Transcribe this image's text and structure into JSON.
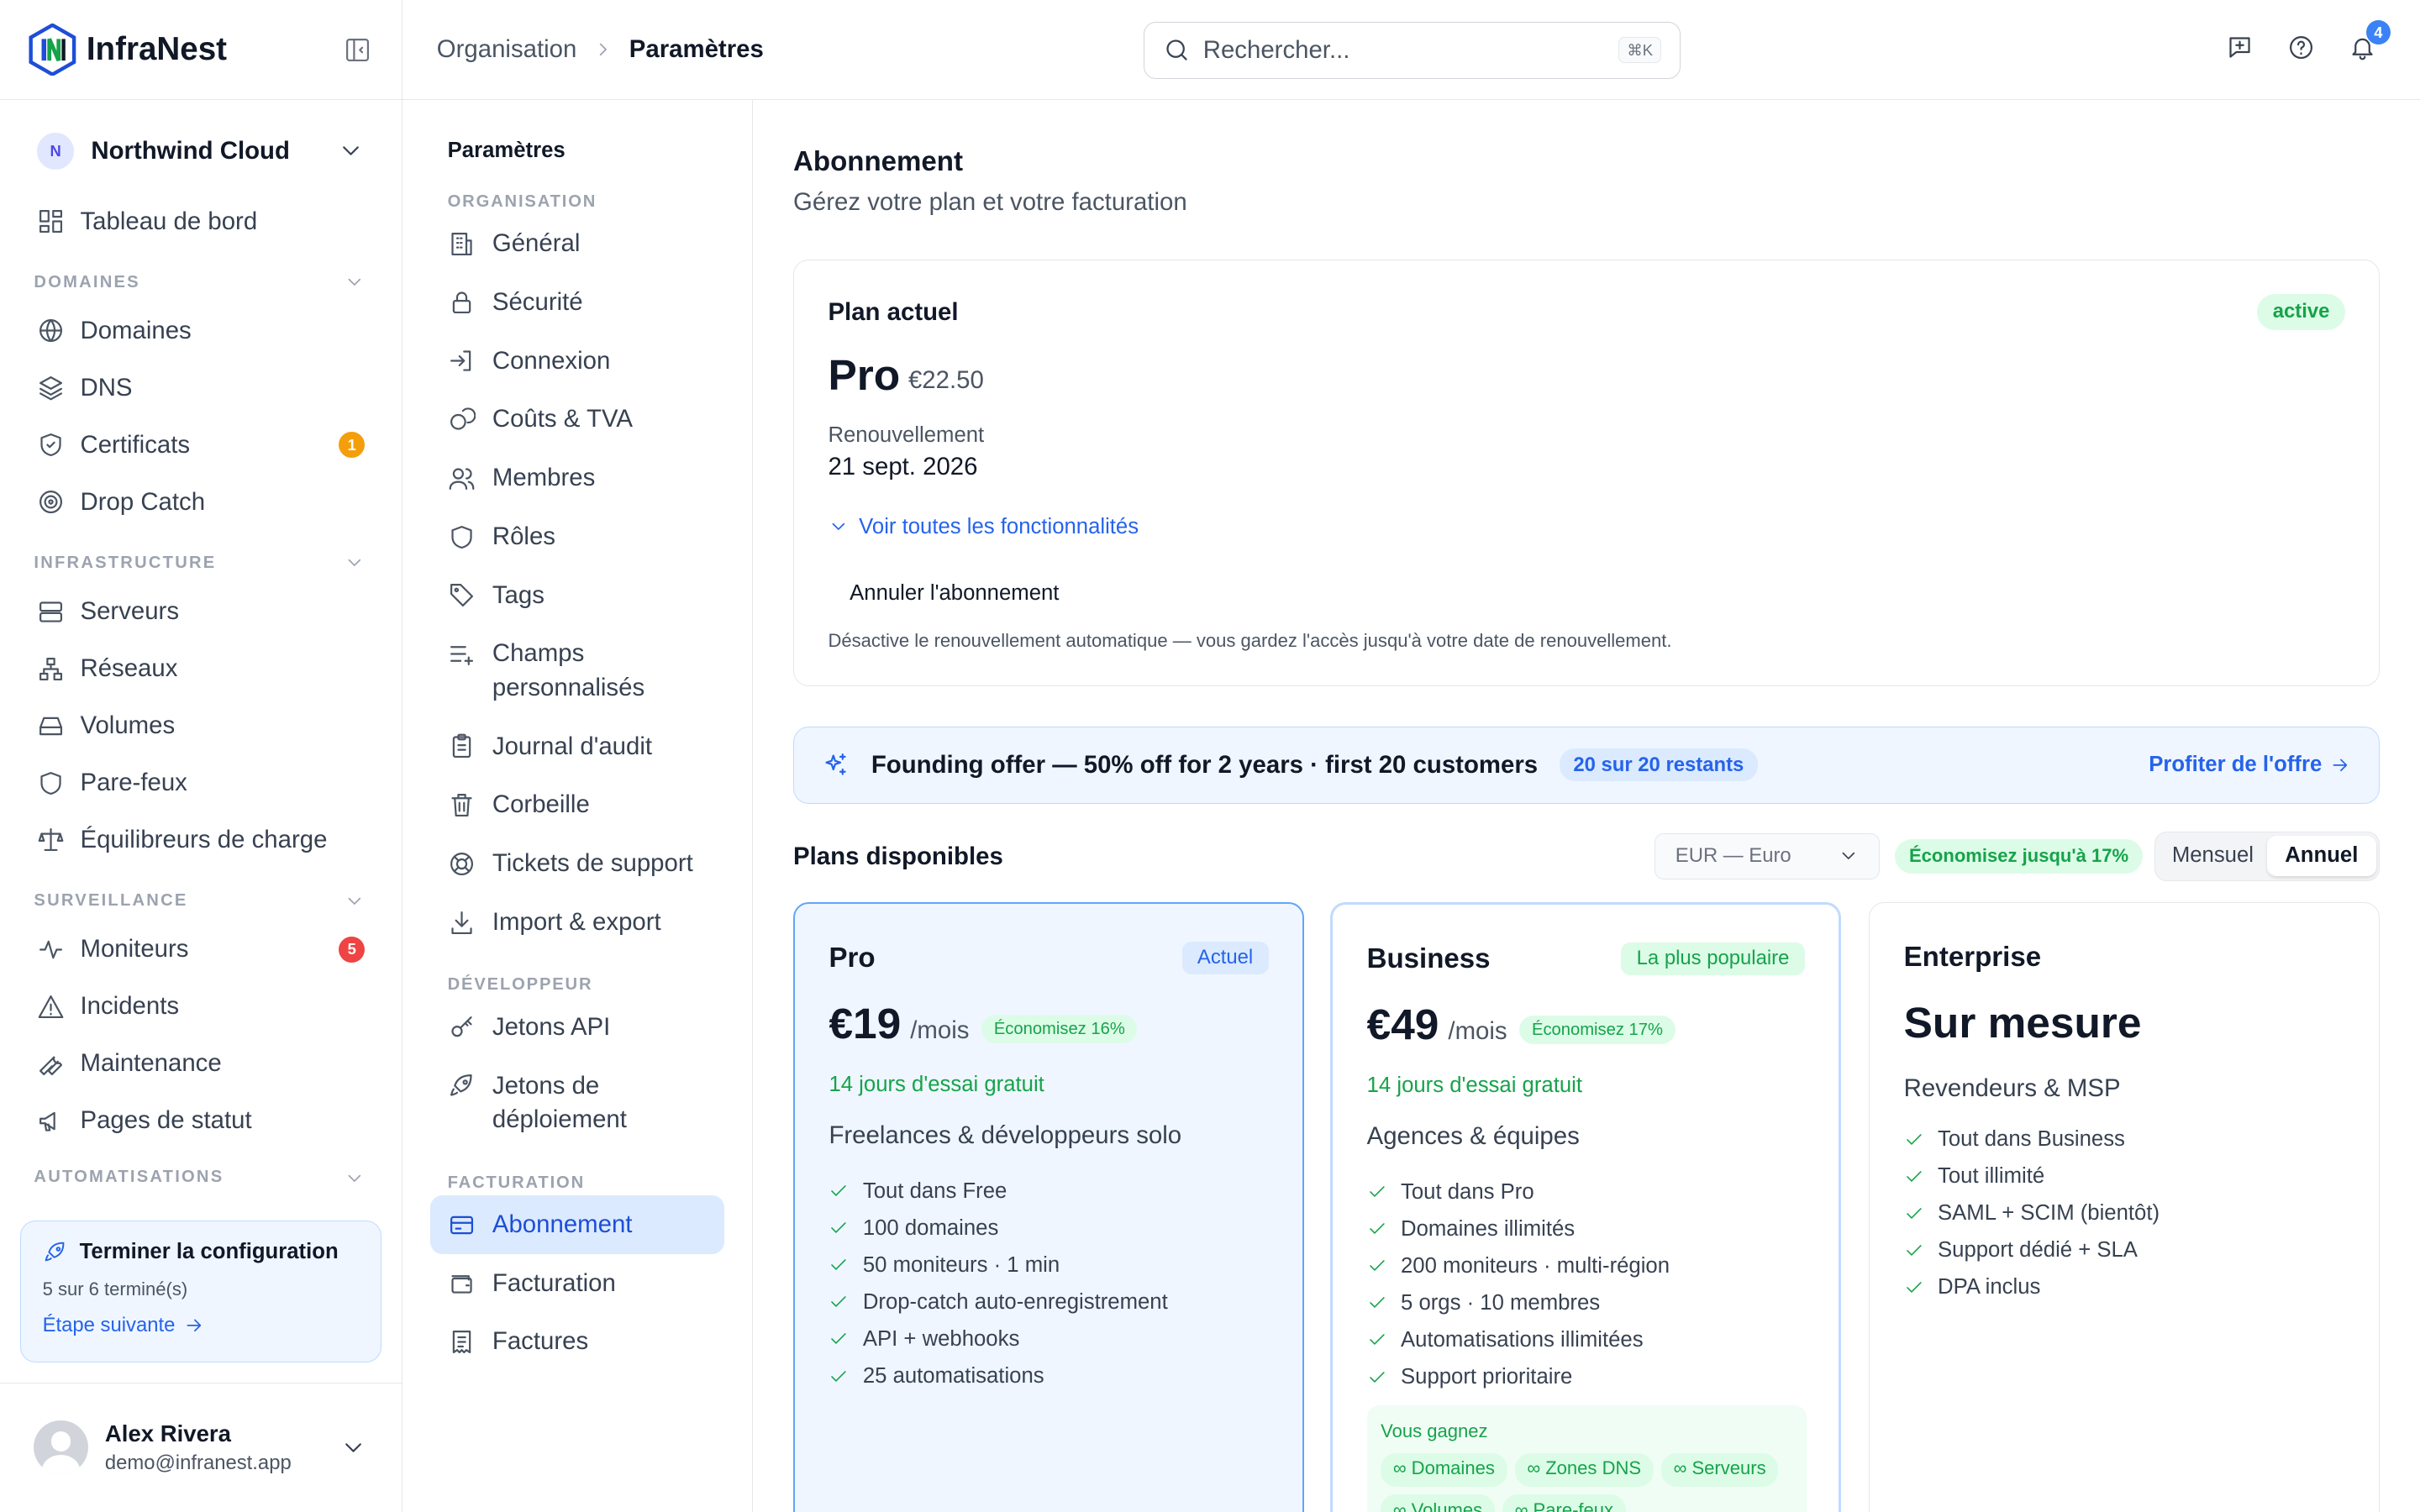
{
  "brand": {
    "name": "InfraNest"
  },
  "org": {
    "initial": "N",
    "name": "Northwind Cloud"
  },
  "sidebar": {
    "top": {
      "label": "Tableau de bord",
      "icon": "dashboard-icon"
    },
    "sections": [
      {
        "title": "DOMAINES",
        "items": [
          {
            "label": "Domaines",
            "icon": "globe-icon"
          },
          {
            "label": "DNS",
            "icon": "layers-icon"
          },
          {
            "label": "Certificats",
            "icon": "shield-check-icon",
            "badge": "1",
            "badge_color": "#f59e0b"
          },
          {
            "label": "Drop Catch",
            "icon": "target-icon"
          }
        ]
      },
      {
        "title": "INFRASTRUCTURE",
        "items": [
          {
            "label": "Serveurs",
            "icon": "server-icon"
          },
          {
            "label": "Réseaux",
            "icon": "network-icon"
          },
          {
            "label": "Volumes",
            "icon": "hard-drive-icon"
          },
          {
            "label": "Pare-feux",
            "icon": "shield-icon"
          },
          {
            "label": "Équilibreurs de charge",
            "icon": "scale-icon"
          }
        ]
      },
      {
        "title": "SURVEILLANCE",
        "items": [
          {
            "label": "Moniteurs",
            "icon": "activity-icon",
            "badge": "5",
            "badge_color": "#ef4444"
          },
          {
            "label": "Incidents",
            "icon": "alert-triangle-icon"
          },
          {
            "label": "Maintenance",
            "icon": "wrench-icon"
          },
          {
            "label": "Pages de statut",
            "icon": "megaphone-icon"
          }
        ]
      },
      {
        "title": "AUTOMATISATIONS",
        "items": []
      }
    ]
  },
  "setup": {
    "title": "Terminer la configuration",
    "progress": "5 sur 6 terminé(s)",
    "next": "Étape suivante"
  },
  "user": {
    "name": "Alex Rivera",
    "email": "demo@infranest.app"
  },
  "topbar": {
    "breadcrumb": [
      "Organisation",
      "Paramètres"
    ],
    "search_placeholder": "Rechercher...",
    "shortcut": "⌘K",
    "notif_count": "4"
  },
  "settings_menu": {
    "title": "Paramètres",
    "groups": [
      {
        "title": "ORGANISATION",
        "items": [
          {
            "label": "Général",
            "icon": "building-icon"
          },
          {
            "label": "Sécurité",
            "icon": "lock-icon"
          },
          {
            "label": "Connexion",
            "icon": "login-icon"
          },
          {
            "label": "Coûts & TVA",
            "icon": "coins-icon"
          },
          {
            "label": "Membres",
            "icon": "users-icon"
          },
          {
            "label": "Rôles",
            "icon": "shield-icon"
          },
          {
            "label": "Tags",
            "icon": "tag-icon"
          },
          {
            "label": "Champs personnalisés",
            "icon": "list-plus-icon"
          },
          {
            "label": "Journal d'audit",
            "icon": "clipboard-icon"
          },
          {
            "label": "Corbeille",
            "icon": "trash-icon"
          },
          {
            "label": "Tickets de support",
            "icon": "lifebuoy-icon"
          },
          {
            "label": "Import & export",
            "icon": "download-icon"
          }
        ]
      },
      {
        "title": "DÉVELOPPEUR",
        "items": [
          {
            "label": "Jetons API",
            "icon": "key-icon"
          },
          {
            "label": "Jetons de déploiement",
            "icon": "rocket-icon"
          }
        ]
      },
      {
        "title": "FACTURATION",
        "items": [
          {
            "label": "Abonnement",
            "icon": "credit-card-icon",
            "active": true
          },
          {
            "label": "Facturation",
            "icon": "wallet-icon"
          },
          {
            "label": "Factures",
            "icon": "receipt-icon"
          }
        ]
      }
    ]
  },
  "page": {
    "title": "Abonnement",
    "subtitle": "Gérez votre plan et votre facturation"
  },
  "current_plan": {
    "title": "Plan actuel",
    "status": "active",
    "name": "Pro",
    "price": "€22.50",
    "renewal_label": "Renouvellement",
    "renewal_date": "21 sept. 2026",
    "features_link": "Voir toutes les fonctionnalités",
    "cancel_label": "Annuler l'abonnement",
    "cancel_desc": "Désactive le renouvellement automatique — vous gardez l'accès jusqu'à votre date de renouvellement."
  },
  "offer": {
    "text": "Founding offer — 50% off for 2 years · first 20 customers",
    "badge": "20 sur 20 restants",
    "cta": "Profiter de l'offre"
  },
  "plans_section": {
    "title": "Plans disponibles",
    "currency": "EUR — Euro",
    "savings": "Économisez jusqu'à 17%",
    "billing": {
      "monthly": "Mensuel",
      "annual": "Annuel"
    }
  },
  "plans": [
    {
      "name": "Pro",
      "tag": "Actuel",
      "price": "€19",
      "period": "/mois",
      "save": "Économisez 16%",
      "trial": "14 jours d'essai gratuit",
      "audience": "Freelances & développeurs solo",
      "features": [
        "Tout dans Free",
        "100 domaines",
        "50 moniteurs · 1 min",
        "Drop-catch auto-enregistrement",
        "API + webhooks",
        "25 automatisations"
      ]
    },
    {
      "name": "Business",
      "tag": "La plus populaire",
      "price": "€49",
      "period": "/mois",
      "save": "Économisez 17%",
      "trial": "14 jours d'essai gratuit",
      "audience": "Agences & équipes",
      "features": [
        "Tout dans Pro",
        "Domaines illimités",
        "200 moniteurs · multi-région",
        "5 orgs · 10 membres",
        "Automatisations illimitées",
        "Support prioritaire"
      ],
      "gain_title": "Vous gagnez",
      "gain_chips": [
        "∞ Domaines",
        "∞ Zones DNS",
        "∞ Serveurs",
        "∞ Volumes",
        "∞ Pare-feux"
      ]
    },
    {
      "name": "Enterprise",
      "custom": "Sur mesure",
      "audience": "Revendeurs & MSP",
      "features": [
        "Tout dans Business",
        "Tout illimité",
        "SAML + SCIM (bientôt)",
        "Support dédié + SLA",
        "DPA inclus"
      ]
    }
  ]
}
